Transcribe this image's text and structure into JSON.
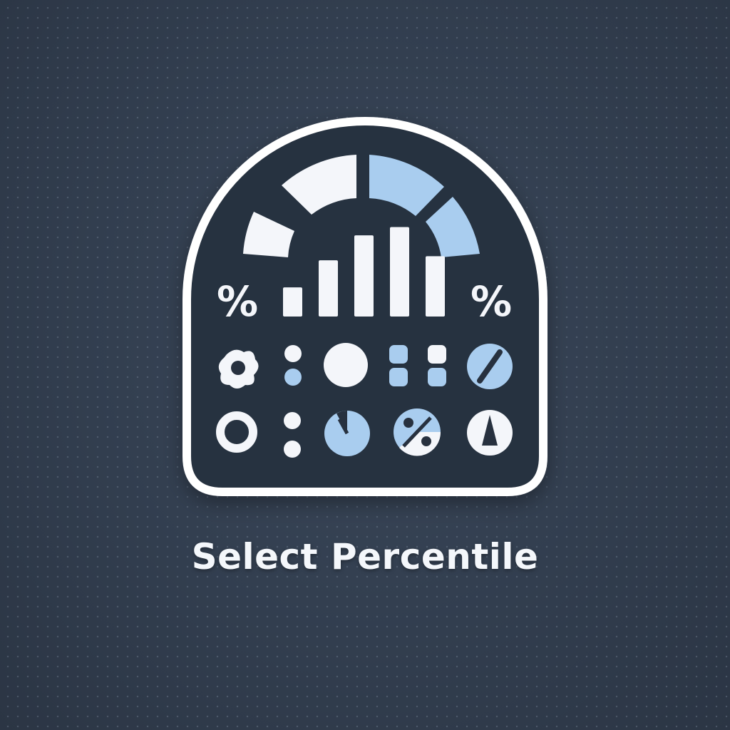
{
  "caption": {
    "label": "Select Percentile"
  },
  "badge": {
    "percent_left": "%",
    "percent_right": "%",
    "gauge_segments": 4,
    "bar_chart_levels": [
      0.28,
      0.54,
      0.78,
      0.86,
      0.58
    ]
  },
  "colors": {
    "background": "#323e4f",
    "badge_fill": "#27313f",
    "outline": "#ffffff",
    "accent": "#a9cdef",
    "icon_white": "#f4f6fa"
  },
  "icons": [
    "gauge-icon",
    "bar-chart-icon",
    "percent-icon",
    "gear-icon",
    "dots-icon",
    "circle-icon",
    "grid-icon",
    "slash-circle-icon",
    "ring-icon",
    "pie-icon",
    "percent-pie-icon",
    "triangle-icon"
  ]
}
